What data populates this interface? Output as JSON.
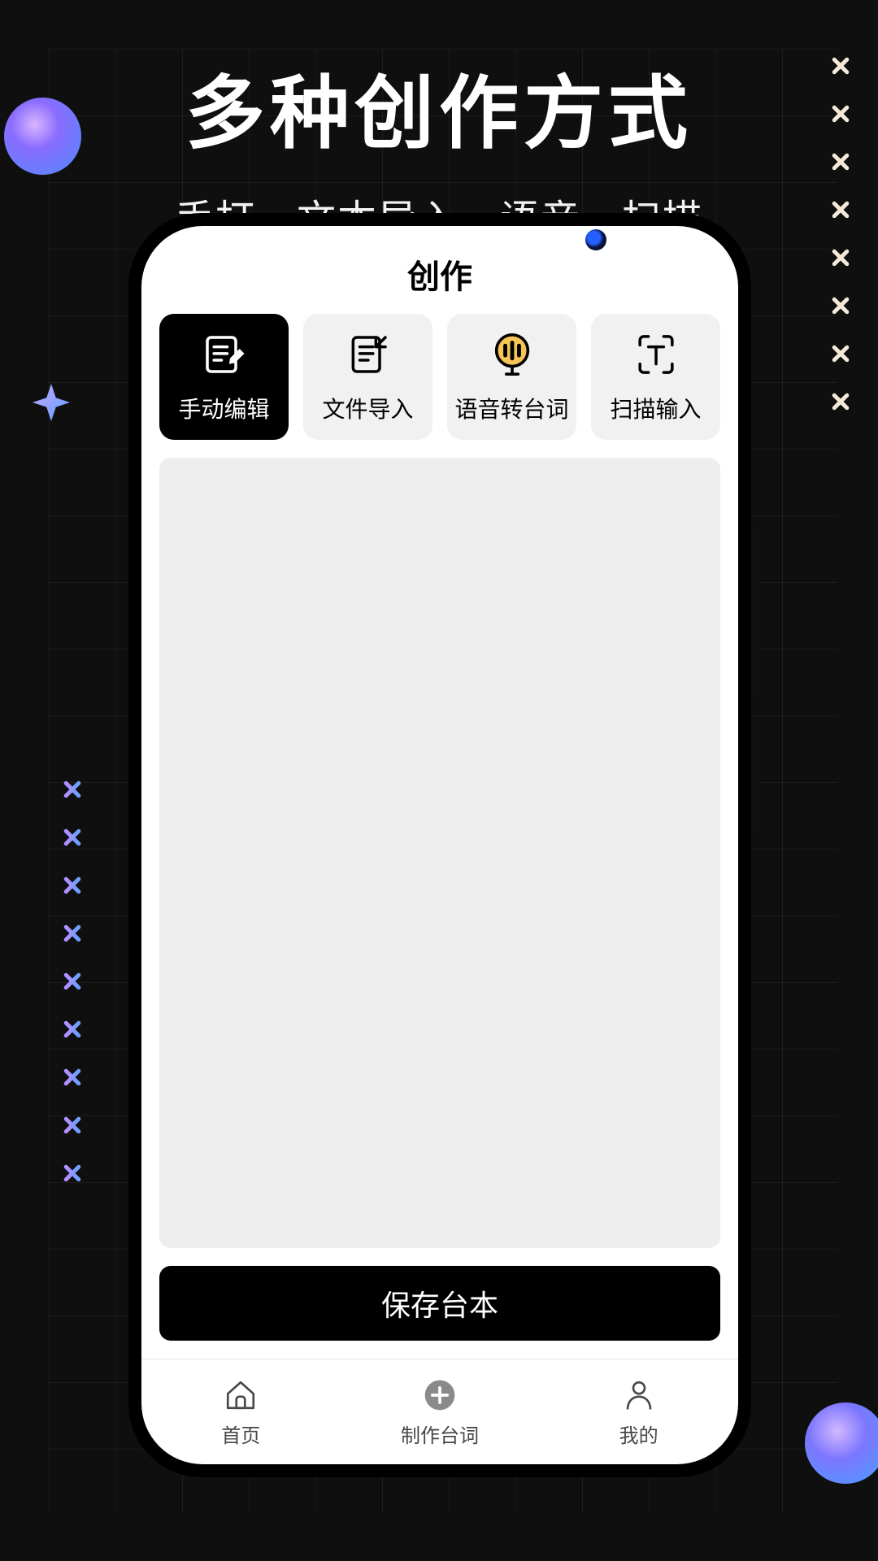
{
  "promo": {
    "title": "多种创作方式",
    "subtitle": "手打、文本导入、语音、扫描"
  },
  "app": {
    "header": "创作",
    "tiles": [
      {
        "label": "手动编辑",
        "icon": "manual-edit-icon",
        "active": true
      },
      {
        "label": "文件导入",
        "icon": "file-import-icon",
        "active": false
      },
      {
        "label": "语音转台词",
        "icon": "voice-to-text-icon",
        "active": false
      },
      {
        "label": "扫描输入",
        "icon": "scan-input-icon",
        "active": false
      }
    ],
    "save_label": "保存台本",
    "nav": [
      {
        "label": "首页",
        "icon": "home-icon"
      },
      {
        "label": "制作台词",
        "icon": "add-icon"
      },
      {
        "label": "我的",
        "icon": "profile-icon"
      }
    ]
  }
}
